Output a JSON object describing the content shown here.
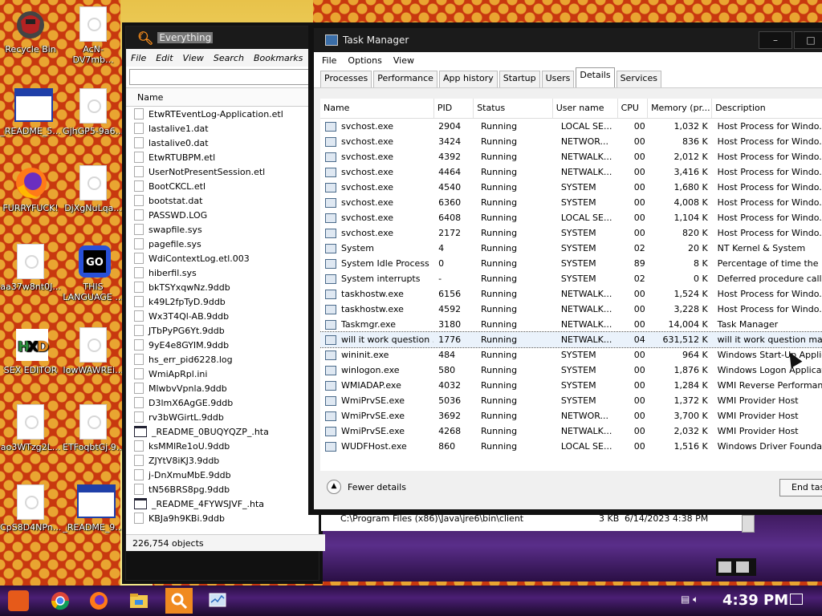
{
  "desktop": {
    "icons": [
      {
        "label": "Recycle Bin",
        "icon": "recycle-bin-icon"
      },
      {
        "label": "AcN-DV7mb...",
        "icon": "file-icon"
      },
      {
        "label": "_README_5...",
        "icon": "window-icon"
      },
      {
        "label": "GjhGP5-9a6...",
        "icon": "file-icon"
      },
      {
        "label": "FURRYFUCK!",
        "icon": "firefox-icon"
      },
      {
        "label": "DjXgNuLqa...",
        "icon": "file-icon"
      },
      {
        "label": "aa37w8nt0J...",
        "icon": "file-icon"
      },
      {
        "label": "THIS LANGUAGE ...",
        "icon": "go-icon"
      },
      {
        "label": "SEX EDITOR",
        "icon": "hxd-icon"
      },
      {
        "label": "IowWAWREi...",
        "icon": "file-icon"
      },
      {
        "label": "ao3WTzg2L...",
        "icon": "file-icon"
      },
      {
        "label": "ETFoqbtGj.9...",
        "icon": "file-icon"
      },
      {
        "label": "CpS8D4NPn...",
        "icon": "file-icon"
      },
      {
        "label": "_README_9...",
        "icon": "window-icon"
      }
    ]
  },
  "everything": {
    "title": "Everything",
    "menu": [
      "File",
      "Edit",
      "View",
      "Search",
      "Bookmarks"
    ],
    "column_name": "Name",
    "files": [
      "EtwRTEventLog-Application.etl",
      "lastalive1.dat",
      "lastalive0.dat",
      "EtwRTUBPM.etl",
      "UserNotPresentSession.etl",
      "BootCKCL.etl",
      "bootstat.dat",
      "PASSWD.LOG",
      "swapfile.sys",
      "pagefile.sys",
      "WdiContextLog.etl.003",
      "hiberfil.sys",
      "bkTSYxqwNz.9ddb",
      "k49L2fpTyD.9ddb",
      "Wx3T4Ql-AB.9ddb",
      "JTbPyPG6Yt.9ddb",
      "9yE4e8GYIM.9ddb",
      "hs_err_pid6228.log",
      "WmiApRpl.ini",
      "MlwbvVpnla.9ddb",
      "D3lmX6AgGE.9ddb",
      "rv3bWGirtL.9ddb",
      "_README_0BUQYQZP_.hta",
      "ksMMlRe1oU.9ddb",
      "ZJYtV8iKJ3.9ddb",
      "j-DnXmuMbE.9ddb",
      "tN56BRS8pg.9ddb",
      "_README_4FYWSJVF_.hta",
      "KBJa9h9KBi.9ddb"
    ],
    "status": "226,754 objects",
    "extra_rows": [
      {
        "path": "C:\\Program Files (x86)\\Java\\jre6\\bin\\client",
        "size": "3 KB",
        "date": "6/14/2023 4:38 PM"
      }
    ]
  },
  "taskmanager": {
    "title": "Task Manager",
    "menu": [
      "File",
      "Options",
      "View"
    ],
    "tabs": [
      "Processes",
      "Performance",
      "App history",
      "Startup",
      "Users",
      "Details",
      "Services"
    ],
    "active_tab": "Details",
    "columns": [
      "Name",
      "PID",
      "Status",
      "User name",
      "CPU",
      "Memory (pr...",
      "Description"
    ],
    "rows": [
      [
        "svchost.exe",
        "2904",
        "Running",
        "LOCAL SE...",
        "00",
        "1,032 K",
        "Host Process for Windo..."
      ],
      [
        "svchost.exe",
        "3424",
        "Running",
        "NETWOR...",
        "00",
        "836 K",
        "Host Process for Windo..."
      ],
      [
        "svchost.exe",
        "4392",
        "Running",
        "NETWALK...",
        "00",
        "2,012 K",
        "Host Process for Windo..."
      ],
      [
        "svchost.exe",
        "4464",
        "Running",
        "NETWALK...",
        "00",
        "3,416 K",
        "Host Process for Windo..."
      ],
      [
        "svchost.exe",
        "4540",
        "Running",
        "SYSTEM",
        "00",
        "1,680 K",
        "Host Process for Windo..."
      ],
      [
        "svchost.exe",
        "6360",
        "Running",
        "SYSTEM",
        "00",
        "4,008 K",
        "Host Process for Windo..."
      ],
      [
        "svchost.exe",
        "6408",
        "Running",
        "LOCAL SE...",
        "00",
        "1,104 K",
        "Host Process for Windo..."
      ],
      [
        "svchost.exe",
        "2172",
        "Running",
        "SYSTEM",
        "00",
        "820 K",
        "Host Process for Windo..."
      ],
      [
        "System",
        "4",
        "Running",
        "SYSTEM",
        "02",
        "20 K",
        "NT Kernel & System"
      ],
      [
        "System Idle Process",
        "0",
        "Running",
        "SYSTEM",
        "89",
        "8 K",
        "Percentage of time the p..."
      ],
      [
        "System interrupts",
        "-",
        "Running",
        "SYSTEM",
        "02",
        "0 K",
        "Deferred procedure call..."
      ],
      [
        "taskhostw.exe",
        "6156",
        "Running",
        "NETWALK...",
        "00",
        "1,524 K",
        "Host Process for Windo..."
      ],
      [
        "taskhostw.exe",
        "4592",
        "Running",
        "NETWALK...",
        "00",
        "3,228 K",
        "Host Process for Windo..."
      ],
      [
        "Taskmgr.exe",
        "3180",
        "Running",
        "NETWALK...",
        "00",
        "14,004 K",
        "Task Manager"
      ],
      [
        "will it work question ...",
        "1776",
        "Running",
        "NETWALK...",
        "04",
        "631,512 K",
        "will it work question mar..."
      ],
      [
        "wininit.exe",
        "484",
        "Running",
        "SYSTEM",
        "00",
        "964 K",
        "Windows Start-Up Applic..."
      ],
      [
        "winlogon.exe",
        "580",
        "Running",
        "SYSTEM",
        "00",
        "1,876 K",
        "Windows Logon Applicati..."
      ],
      [
        "WMIADAP.exe",
        "4032",
        "Running",
        "SYSTEM",
        "00",
        "1,284 K",
        "WMI Reverse Performan..."
      ],
      [
        "WmiPrvSE.exe",
        "5036",
        "Running",
        "SYSTEM",
        "00",
        "1,372 K",
        "WMI Provider Host"
      ],
      [
        "WmiPrvSE.exe",
        "3692",
        "Running",
        "NETWOR...",
        "00",
        "3,700 K",
        "WMI Provider Host"
      ],
      [
        "WmiPrvSE.exe",
        "4268",
        "Running",
        "NETWALK...",
        "00",
        "2,032 K",
        "WMI Provider Host"
      ],
      [
        "WUDFHost.exe",
        "860",
        "Running",
        "LOCAL SE...",
        "00",
        "1,516 K",
        "Windows Driver Foundati..."
      ]
    ],
    "selected_row_index": 14,
    "fewer_details": "Fewer details",
    "end_task": "End task"
  },
  "taskbar": {
    "clock": "4:39 PM",
    "items": [
      "start-icon",
      "chrome-icon",
      "firefox-icon",
      "file-explorer-icon",
      "everything-icon",
      "task-manager-icon"
    ]
  }
}
